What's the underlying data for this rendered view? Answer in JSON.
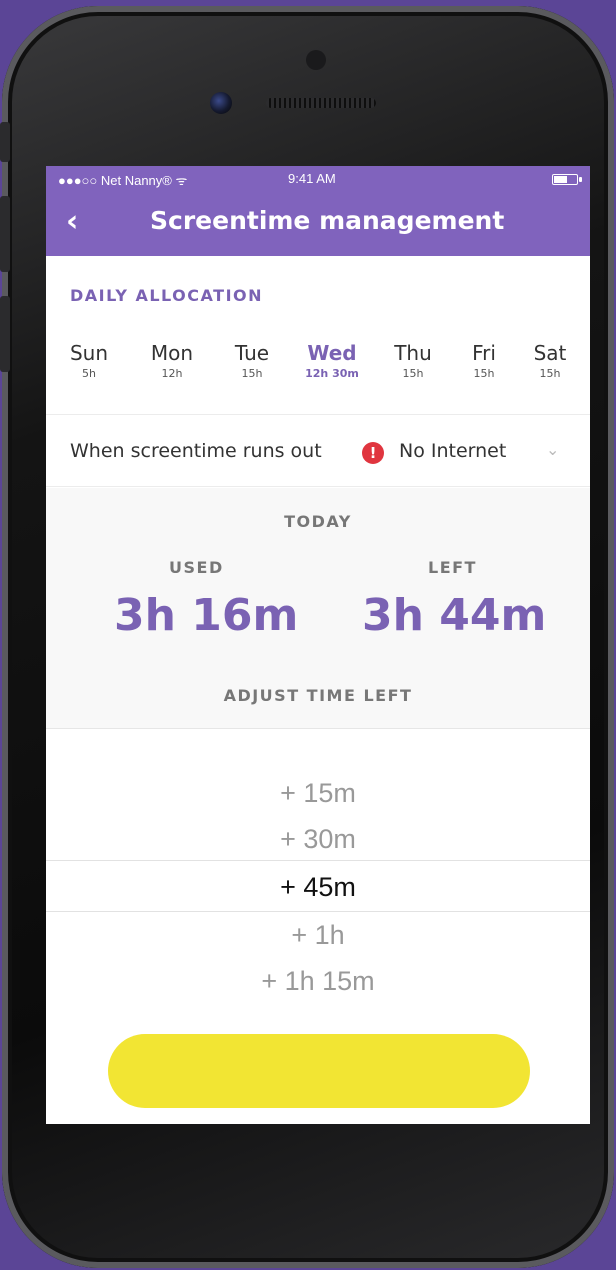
{
  "status_bar": {
    "carrier": "●●●○○ Net Nanny® ᯤ",
    "time": "9:41 AM"
  },
  "header": {
    "back_glyph": "‹",
    "title": "Screentime management"
  },
  "daily_allocation": {
    "label": "DAILY ALLOCATION",
    "days": [
      {
        "name": "Sun",
        "value": "5h",
        "active": false
      },
      {
        "name": "Mon",
        "value": "12h",
        "active": false
      },
      {
        "name": "Tue",
        "value": "15h",
        "active": false
      },
      {
        "name": "Wed",
        "value": "12h 30m",
        "active": true
      },
      {
        "name": "Thu",
        "value": "15h",
        "active": false
      },
      {
        "name": "Fri",
        "value": "15h",
        "active": false
      },
      {
        "name": "Sat",
        "value": "15h",
        "active": false
      }
    ]
  },
  "runout": {
    "label": "When screentime runs out",
    "alert_glyph": "!",
    "value": "No Internet",
    "chevron_glyph": "⌄"
  },
  "today": {
    "label": "TODAY",
    "used_label": "USED",
    "used_value": "3h 16m",
    "left_label": "LEFT",
    "left_value": "3h 44m",
    "adjust_label": "ADJUST TIME LEFT"
  },
  "picker": {
    "options": [
      "+ 15m",
      "+ 30m",
      "+ 45m",
      "+ 1h",
      "+ 1h 15m"
    ],
    "selected_index": 2
  },
  "colors": {
    "brand": "#8063bd",
    "accent_text": "#7a62b3",
    "cta": "#f2e533",
    "alert": "#e0353f"
  },
  "icons": {
    "back": "chevron-left-icon",
    "alert": "alert-icon",
    "dropdown": "chevron-down-icon",
    "battery": "battery-icon",
    "wifi": "wifi-icon"
  }
}
